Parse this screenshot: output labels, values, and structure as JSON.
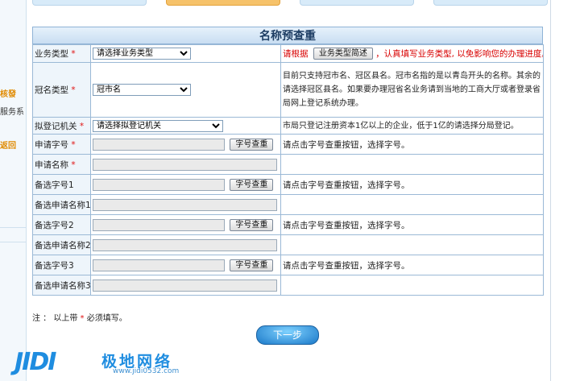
{
  "sidebar": {
    "item1": "核發",
    "item2": "服务系",
    "item3": "返回"
  },
  "form": {
    "title": "名称预查重",
    "rows": {
      "biz_type": {
        "label": "业务类型",
        "select_value": "请选择业务类型",
        "hint_prefix": "请根据",
        "hint_button": "业务类型简述",
        "hint_suffix": "，认真填写业务类型, 以免影响您的办理进度。"
      },
      "crown_type": {
        "label": "冠名类型",
        "select_value": "冠市名",
        "info": "目前只支持冠市名、冠区县名。冠市名指的是以青岛开头的名称。其余的请选择冠区县名。如果要办理冠省名业务请到当地的工商大厅或者登录省局网上登记系统办理。"
      },
      "agency": {
        "label": "拟登记机关",
        "select_value": "请选择拟登记机关",
        "info": "市局只登记注册资本1亿以上的企业，低于1亿的请选择分局登记。"
      },
      "apply_word": {
        "label": "申请字号",
        "button": "字号查重",
        "info": "请点击字号查重按钮，选择字号。"
      },
      "apply_name": {
        "label": "申请名称"
      },
      "alt_word1": {
        "label": "备选字号1",
        "button": "字号查重",
        "info": "请点击字号查重按钮，选择字号。"
      },
      "alt_name1": {
        "label": "备选申请名称1"
      },
      "alt_word2": {
        "label": "备选字号2",
        "button": "字号查重",
        "info": "请点击字号查重按钮，选择字号。"
      },
      "alt_name2": {
        "label": "备选申请名称2"
      },
      "alt_word3": {
        "label": "备选字号3",
        "button": "字号查重",
        "info": "请点击字号查重按钮，选择字号。"
      },
      "alt_name3": {
        "label": "备选申请名称3"
      }
    },
    "required_mark": "*",
    "note_prefix": "注 ： 以上带",
    "note_suffix": "必须填写。",
    "next_button": "下一步"
  },
  "watermark": {
    "mark": "JIDI",
    "name": "极地网络",
    "url": "www.jidi0532.com"
  },
  "colors": {
    "accent": "#1f8de0",
    "required": "#e01010",
    "border": "#9bb9d6"
  }
}
